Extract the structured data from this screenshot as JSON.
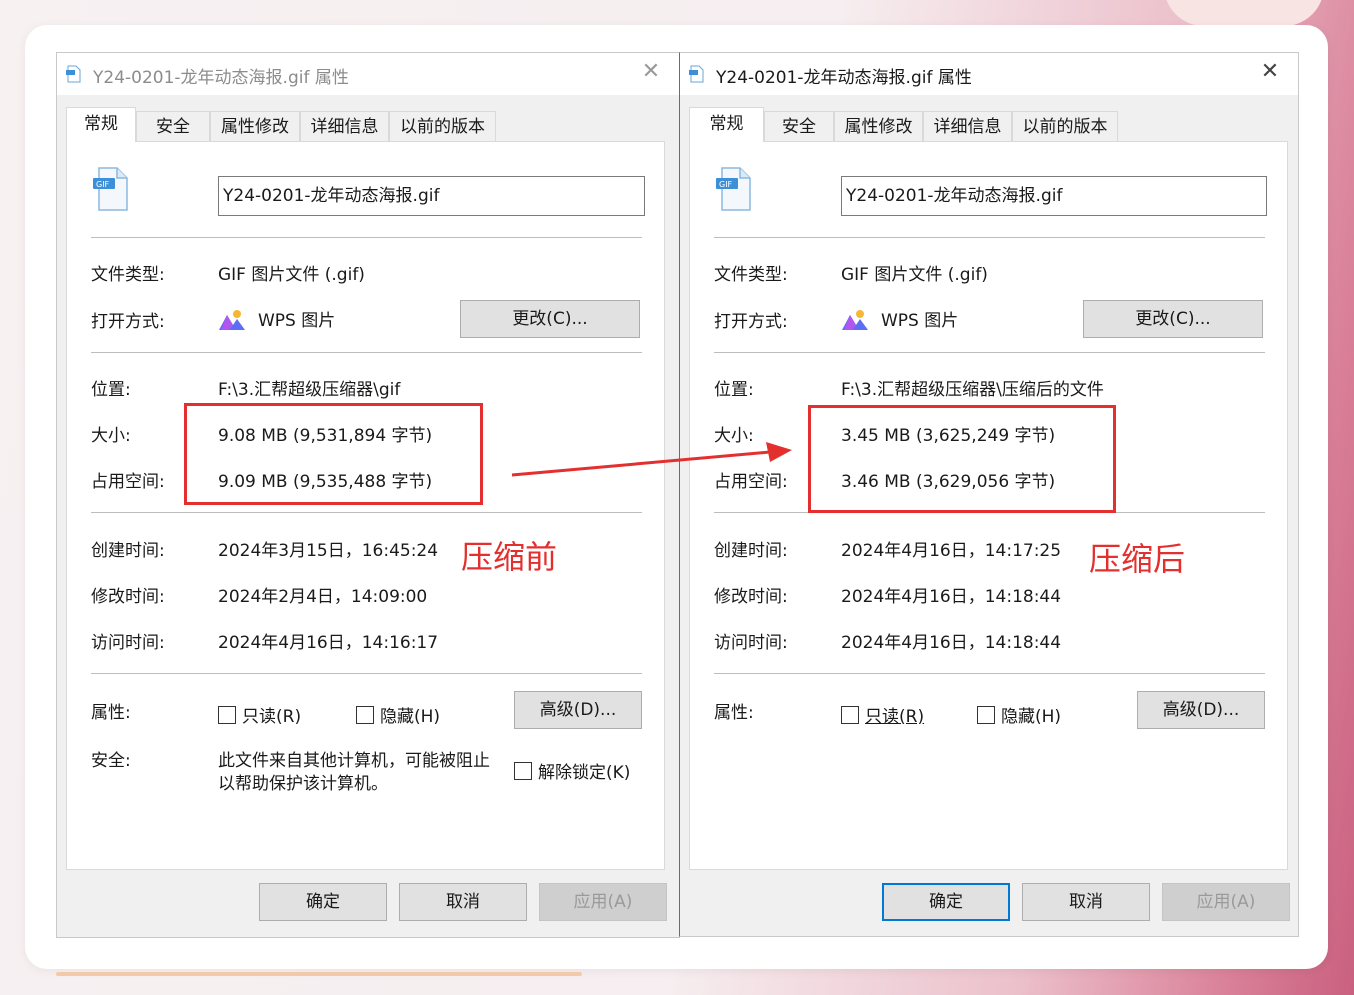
{
  "left": {
    "title": "Y24-0201-龙年动态海报.gif 属性",
    "tabs": [
      "常规",
      "安全",
      "属性修改",
      "详细信息",
      "以前的版本"
    ],
    "filename": "Y24-0201-龙年动态海报.gif",
    "labels": {
      "type": "文件类型:",
      "open": "打开方式:",
      "location": "位置:",
      "size": "大小:",
      "disk": "占用空间:",
      "created": "创建时间:",
      "modified": "修改时间:",
      "accessed": "访问时间:",
      "attrs": "属性:",
      "security": "安全:"
    },
    "values": {
      "type": "GIF 图片文件 (.gif)",
      "open": "WPS 图片",
      "location": "F:\\3.汇帮超级压缩器\\gif",
      "size": "9.08 MB (9,531,894 字节)",
      "disk": "9.09 MB (9,535,488 字节)",
      "created": "2024年3月15日，16:45:24",
      "modified": "2024年2月4日，14:09:00",
      "accessed": "2024年4月16日，14:16:17",
      "security_1": "此文件来自其他计算机，可能被阻止",
      "security_2": "以帮助保护该计算机。"
    },
    "buttons": {
      "change": "更改(C)...",
      "advanced": "高级(D)...",
      "ok": "确定",
      "cancel": "取消",
      "apply": "应用(A)"
    },
    "checkboxes": {
      "readonly": "只读(R)",
      "hidden": "隐藏(H)",
      "unblock": "解除锁定(K)"
    },
    "annotation": "压缩前"
  },
  "right": {
    "title": "Y24-0201-龙年动态海报.gif 属性",
    "tabs": [
      "常规",
      "安全",
      "属性修改",
      "详细信息",
      "以前的版本"
    ],
    "filename": "Y24-0201-龙年动态海报.gif",
    "labels": {
      "type": "文件类型:",
      "open": "打开方式:",
      "location": "位置:",
      "size": "大小:",
      "disk": "占用空间:",
      "created": "创建时间:",
      "modified": "修改时间:",
      "accessed": "访问时间:",
      "attrs": "属性:"
    },
    "values": {
      "type": "GIF 图片文件 (.gif)",
      "open": "WPS 图片",
      "location": "F:\\3.汇帮超级压缩器\\压缩后的文件",
      "size": "3.45 MB (3,625,249 字节)",
      "disk": "3.46 MB (3,629,056 字节)",
      "created": "2024年4月16日，14:17:25",
      "modified": "2024年4月16日，14:18:44",
      "accessed": "2024年4月16日，14:18:44"
    },
    "buttons": {
      "change": "更改(C)...",
      "advanced": "高级(D)...",
      "ok": "确定",
      "cancel": "取消",
      "apply": "应用(A)"
    },
    "checkboxes": {
      "readonly": "只读(R)",
      "hidden": "隐藏(H)"
    },
    "annotation": "压缩后"
  },
  "icons": {
    "file": "gif-file-icon",
    "app": "wps-picture-icon",
    "close": "close-icon",
    "arrow": "red-arrow"
  },
  "colors": {
    "annotation": "#e42f2f",
    "focus": "#0078d4"
  }
}
